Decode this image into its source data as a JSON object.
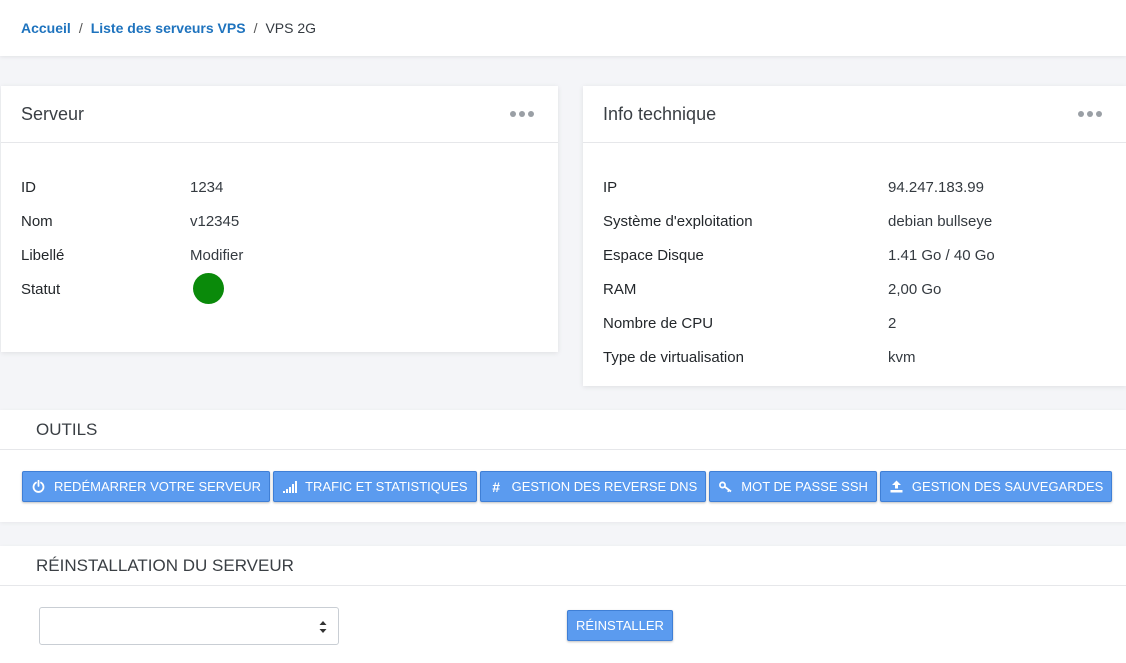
{
  "breadcrumb": {
    "home": "Accueil",
    "list": "Liste des serveurs VPS",
    "current": "VPS 2G"
  },
  "serveur": {
    "title": "Serveur",
    "rows": [
      {
        "label": "ID",
        "value": "1234"
      },
      {
        "label": "Nom",
        "value": "v12345"
      },
      {
        "label": "Libellé",
        "value": "Modifier"
      },
      {
        "label": "Statut",
        "value": ""
      }
    ],
    "status_color": "#0a8a0a"
  },
  "info": {
    "title": "Info technique",
    "rows": [
      {
        "label": "IP",
        "value": "94.247.183.99"
      },
      {
        "label": "Système d'exploitation",
        "value": "debian bullseye"
      },
      {
        "label": "Espace Disque",
        "value": "1.41 Go / 40 Go"
      },
      {
        "label": "RAM",
        "value": "2,00 Go"
      },
      {
        "label": "Nombre de CPU",
        "value": "2"
      },
      {
        "label": "Type de virtualisation",
        "value": "kvm"
      }
    ]
  },
  "outils": {
    "title": "OUTILS",
    "buttons": [
      {
        "label": "REDÉMARRER VOTRE SERVEUR",
        "icon": "power-icon"
      },
      {
        "label": "TRAFIC ET STATISTIQUES",
        "icon": "signal-icon"
      },
      {
        "label": "GESTION DES REVERSE DNS",
        "icon": "hashtag-icon"
      },
      {
        "label": "MOT DE PASSE SSH",
        "icon": "key-icon"
      },
      {
        "label": "GESTION DES SAUVEGARDES",
        "icon": "upload-icon"
      }
    ]
  },
  "reinstall": {
    "title": "RÉINSTALLATION DU SERVEUR",
    "select_value": "",
    "button_label": "RÉINSTALLER"
  },
  "colors": {
    "link": "#1e73be",
    "button": "#5b9bef",
    "status_ok": "#0a8a0a"
  }
}
